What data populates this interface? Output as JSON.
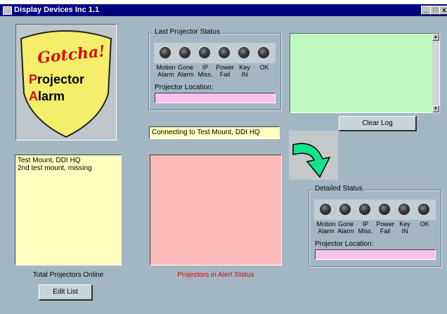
{
  "window": {
    "title": "Display Devices Inc 1.1",
    "controls": [
      "_",
      "□",
      "x"
    ]
  },
  "logo": {
    "line1": "Gotcha!",
    "line2_first": "P",
    "line2_rest": "rojector",
    "line3_first": "A",
    "line3_rest": "larm"
  },
  "last_status": {
    "legend": "Last Projector Status",
    "indicators": [
      {
        "line1": "Motion",
        "line2": "Alarm"
      },
      {
        "line1": "Gone",
        "line2": "Alarm"
      },
      {
        "line1": "IP",
        "line2": "Miss."
      },
      {
        "line1": "Power",
        "line2": "Fail"
      },
      {
        "line1": "Key",
        "line2": "IN"
      },
      {
        "line1": "OK",
        "line2": ""
      }
    ],
    "location_label": "Projector Location:",
    "location_value": ""
  },
  "log": {
    "clear_label": "Clear Log",
    "log_color": "#bff9bf"
  },
  "connection": {
    "status_text": "Connecting to Test Mount, DDI HQ"
  },
  "projector_list": {
    "items": [
      "Test Mount, DDI HQ",
      "2nd test mount, missing"
    ],
    "caption": "Total Projectors Online",
    "edit_label": "Edit List"
  },
  "alert_list": {
    "caption": "Projectors in Alert Status",
    "caption_color": "#e00000",
    "bg_color": "#f9b9b9"
  },
  "detailed_status": {
    "legend": "Detailed Status",
    "indicators": [
      {
        "line1": "Motion",
        "line2": "Alarm"
      },
      {
        "line1": "Gone",
        "line2": "Alarm"
      },
      {
        "line1": "IP",
        "line2": "Miss."
      },
      {
        "line1": "Power",
        "line2": "Fail"
      },
      {
        "line1": "Key",
        "line2": "IN"
      },
      {
        "line1": "OK",
        "line2": ""
      }
    ],
    "location_label": "Projector Location:",
    "location_value": ""
  },
  "colors": {
    "window_bg": "#a3b7c3",
    "titlebar": "#00007f",
    "yellow_field": "#ffffbf",
    "pink_field": "#f9c1ef",
    "arrow": "#13e28a"
  }
}
